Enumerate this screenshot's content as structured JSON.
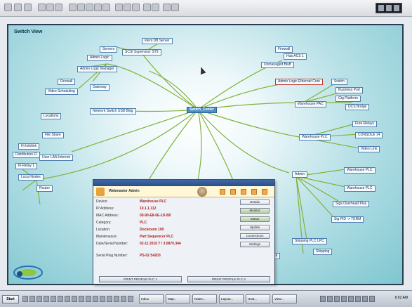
{
  "map": {
    "title": "Switch View",
    "central_node": "Switch_Center",
    "nodes": [
      {
        "label": "Ident DB Server"
      },
      {
        "label": "SCSI Supervisor ST9"
      },
      {
        "label": "Servers"
      },
      {
        "label": "Admin Logic"
      },
      {
        "label": "Admin Logic Manager"
      },
      {
        "label": "Firewall"
      },
      {
        "label": "Gateway"
      },
      {
        "label": "Video Scheduling"
      },
      {
        "label": "Network Switch USB Bldg"
      },
      {
        "label": "Locations"
      },
      {
        "label": "File Share"
      },
      {
        "label": "Hi Infolink"
      },
      {
        "label": "Distribution FI"
      },
      {
        "label": "User LAN Internet"
      },
      {
        "label": "FI-Relay 1"
      },
      {
        "label": "Router"
      },
      {
        "label": "Local Nodes"
      },
      {
        "label": "Firewall"
      },
      {
        "label": "Hub ACS 1"
      },
      {
        "label": "Unmanaged Bluff"
      },
      {
        "label": "Admin Logic Ethernet Core"
      },
      {
        "label": "Switch"
      },
      {
        "label": "Business Port"
      },
      {
        "label": "Gig Platform"
      },
      {
        "label": "DCS Bridge"
      },
      {
        "label": "Warehouse PAC"
      },
      {
        "label": "Free Relays"
      },
      {
        "label": "CONSOLE 14"
      },
      {
        "label": "Video Link"
      },
      {
        "label": "Warehouse PLC"
      },
      {
        "label": "Admin"
      },
      {
        "label": "Warehouse PLC"
      },
      {
        "label": "Warehouse PLC"
      },
      {
        "label": "Sigs Overhead Plus"
      },
      {
        "label": "Sig PID -> TERM"
      },
      {
        "label": "Shipping PLC LPC"
      },
      {
        "label": "Shipping"
      },
      {
        "label": "Copy Area"
      }
    ]
  },
  "dialog": {
    "banner_title": "Webmaster Admin",
    "rows": [
      {
        "key": "Device:",
        "value": "Warehouse PLC"
      },
      {
        "key": "IP Address:",
        "value": "10.1.1.112"
      },
      {
        "key": "MAC Address:",
        "value": "00-90-E8-0E-1D-B0"
      },
      {
        "key": "Category:",
        "value": "PLC"
      },
      {
        "key": "Location:",
        "value": "Dockroom 100"
      },
      {
        "key": "Maintenance:",
        "value": "Part Sequencer PLC"
      },
      {
        "key": "Date/Serial Number:",
        "value": "02-11 2010 T / 3.0870.344"
      },
      {
        "key": "Serial Plug Number:",
        "value": "PS-02 S4203"
      }
    ],
    "side_buttons": [
      "Details",
      "Monitor",
      "Status",
      "Update",
      "Connections",
      "Settings"
    ],
    "footer_buttons": [
      "PRINT PROFILE PLC 1",
      "PRINT PROFILE PLC 2"
    ]
  },
  "taskbar": {
    "start_label": "Start",
    "tasks": [
      "Inbox",
      "Map...",
      "Notes...",
      "Layout...",
      "Host...",
      "View..."
    ],
    "clock": "6:02 AM"
  },
  "colors": {
    "map_center": "#ffffff",
    "map_edge": "#7fc6d0",
    "link_color": "#7fb33a",
    "node_border": "#4f7fae",
    "highlight_node": "#c03a2b",
    "central_node_fill": "#4a8fc8",
    "dialog_value": "#b3191b"
  }
}
